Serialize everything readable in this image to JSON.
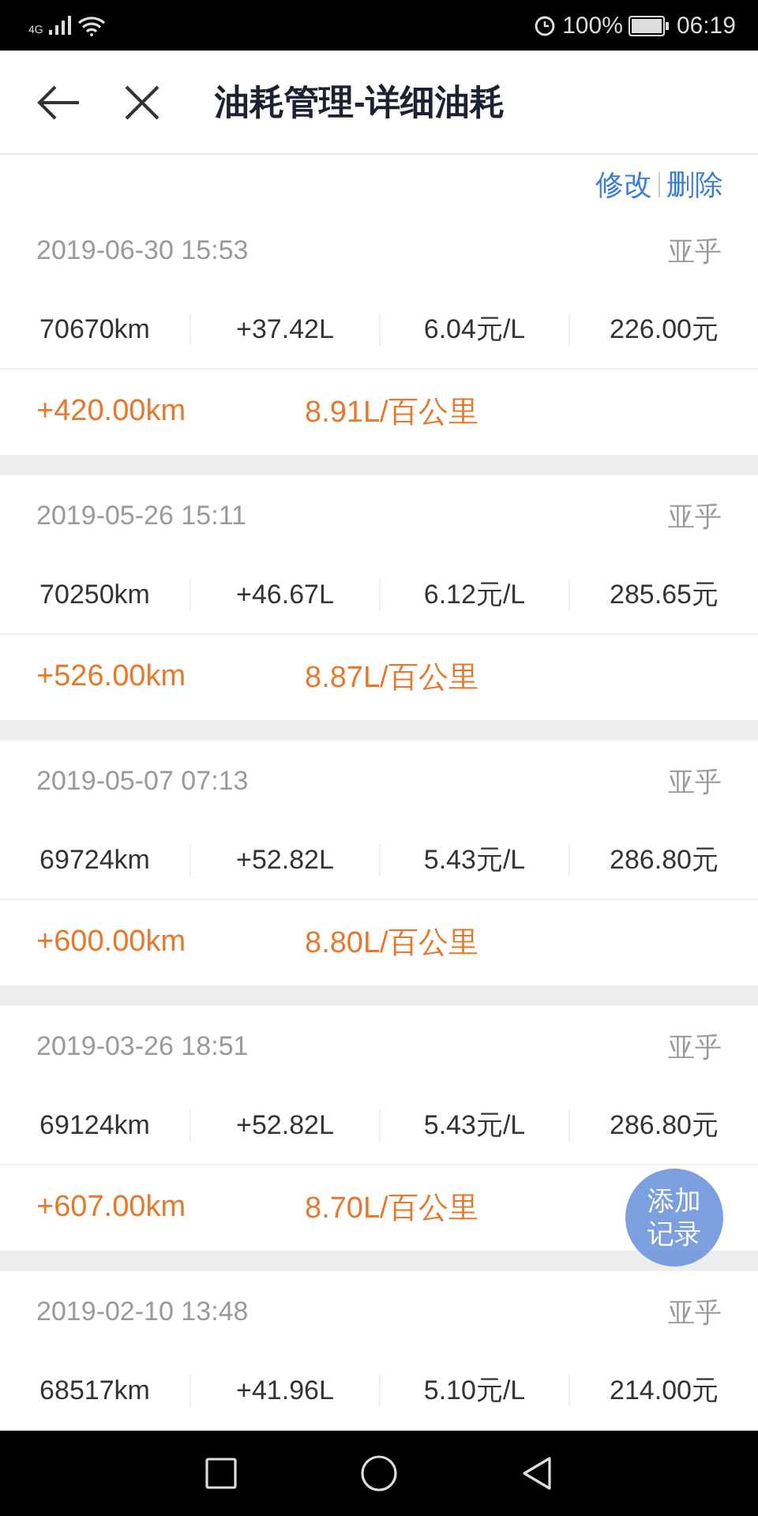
{
  "status_bar": {
    "network": "4G",
    "battery": "100%",
    "time": "06:19"
  },
  "header": {
    "title": "油耗管理-详细油耗"
  },
  "actions": [
    "修改",
    "删除"
  ],
  "records": [
    {
      "date": "2019-06-30 15:53",
      "owner": "亚乎",
      "odometer": "70670km",
      "volume": "+37.42L",
      "unit_price": "6.04元/L",
      "cost": "226.00元",
      "distance": "+420.00km",
      "consumption": "8.91L/百公里"
    },
    {
      "date": "2019-05-26 15:11",
      "owner": "亚乎",
      "odometer": "70250km",
      "volume": "+46.67L",
      "unit_price": "6.12元/L",
      "cost": "285.65元",
      "distance": "+526.00km",
      "consumption": "8.87L/百公里"
    },
    {
      "date": "2019-05-07 07:13",
      "owner": "亚乎",
      "odometer": "69724km",
      "volume": "+52.82L",
      "unit_price": "5.43元/L",
      "cost": "286.80元",
      "distance": "+600.00km",
      "consumption": "8.80L/百公里"
    },
    {
      "date": "2019-03-26 18:51",
      "owner": "亚乎",
      "odometer": "69124km",
      "volume": "+52.82L",
      "unit_price": "5.43元/L",
      "cost": "286.80元",
      "distance": "+607.00km",
      "consumption": "8.70L/百公里"
    },
    {
      "date": "2019-02-10 13:48",
      "owner": "亚乎",
      "odometer": "68517km",
      "volume": "+41.96L",
      "unit_price": "5.10元/L",
      "cost": "214.00元"
    }
  ],
  "fab": {
    "label": "添加记录"
  }
}
